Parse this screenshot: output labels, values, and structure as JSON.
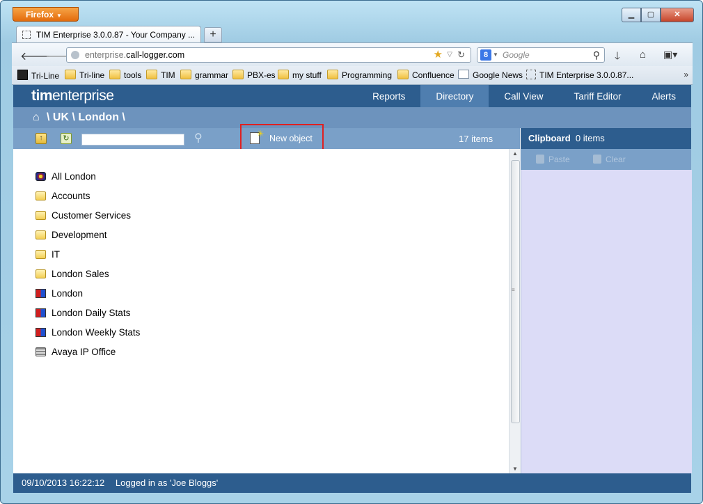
{
  "browser": {
    "menu_label": "Firefox",
    "tab_title": "TIM Enterprise 3.0.0.87 - Your Company ...",
    "new_tab": "+",
    "url_prefix": "enterprise.",
    "url_host": "call-logger.com",
    "search_placeholder": "Google",
    "bookmarks": [
      {
        "label": "Tri-Line",
        "icon": "tri-line-icon"
      },
      {
        "label": "Tri-line",
        "icon": "folder-icon"
      },
      {
        "label": "tools",
        "icon": "folder-icon"
      },
      {
        "label": "TIM",
        "icon": "folder-icon"
      },
      {
        "label": "grammar",
        "icon": "folder-icon"
      },
      {
        "label": "PBX-es",
        "icon": "folder-icon"
      },
      {
        "label": "my stuff",
        "icon": "folder-icon"
      },
      {
        "label": "Programming",
        "icon": "folder-icon"
      },
      {
        "label": "Confluence",
        "icon": "folder-icon"
      },
      {
        "label": "Google News",
        "icon": "news-icon"
      },
      {
        "label": "TIM Enterprise 3.0.0.87...",
        "icon": "page-icon"
      }
    ],
    "overflow": "»"
  },
  "app": {
    "logo_bold": "tim",
    "logo_rest": "enterprise",
    "nav": [
      {
        "label": "Reports",
        "active": false
      },
      {
        "label": "Directory",
        "active": true
      },
      {
        "label": "Call View",
        "active": false
      },
      {
        "label": "Tariff Editor",
        "active": false
      },
      {
        "label": "Alerts",
        "active": false
      }
    ],
    "breadcrumb": "\\ UK \\ London \\",
    "toolbar": {
      "new_object": "New object",
      "item_count": "17 items"
    },
    "clipboard": {
      "title": "Clipboard",
      "count": "0 items",
      "paste": "Paste",
      "clear": "Clear"
    },
    "items": [
      {
        "label": "All London",
        "icon": "group-icon"
      },
      {
        "label": "Accounts",
        "icon": "folder-icon"
      },
      {
        "label": "Customer Services",
        "icon": "folder-icon"
      },
      {
        "label": "Development",
        "icon": "folder-icon"
      },
      {
        "label": "IT",
        "icon": "folder-icon"
      },
      {
        "label": "London Sales",
        "icon": "folder-icon"
      },
      {
        "label": "London",
        "icon": "report-icon"
      },
      {
        "label": "London Daily Stats",
        "icon": "report-icon"
      },
      {
        "label": "London Weekly Stats",
        "icon": "report-icon"
      },
      {
        "label": "Avaya IP Office",
        "icon": "device-icon"
      }
    ],
    "status": {
      "datetime": "09/10/2013 16:22:12",
      "user": "Logged in as 'Joe Bloggs'"
    }
  }
}
